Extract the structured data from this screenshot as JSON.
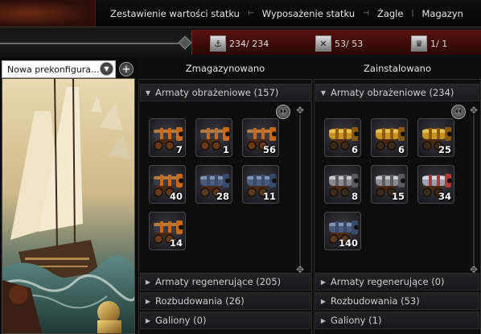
{
  "tabs": [
    {
      "label": "Zestawienie wartości statku"
    },
    {
      "label": "Wyposażenie statku"
    },
    {
      "label": "Żagle"
    },
    {
      "label": "Magazyn"
    }
  ],
  "tab_separators": [
    "⊢",
    "⊣",
    "|"
  ],
  "resources": [
    {
      "icon": "crew-icon",
      "value": "234/ 234"
    },
    {
      "icon": "cannon-slots-icon",
      "value": "53/ 53"
    },
    {
      "icon": "figurehead-icon",
      "value": "1/ 1"
    }
  ],
  "preset": {
    "label": "Nowa prekonfigura...",
    "add_label": "+",
    "arrow": "▼"
  },
  "stored": {
    "title": "Zmagazynowano",
    "categories": [
      {
        "label": "Armaty obrażeniowe (157)",
        "open": true
      },
      {
        "label": "Armaty regenerujące (205)",
        "open": false
      },
      {
        "label": "Rozbudowania (26)",
        "open": false
      },
      {
        "label": "Galiony (0)",
        "open": false
      }
    ],
    "items": [
      {
        "type": "orange-cannon",
        "count": "7"
      },
      {
        "type": "orange-cannon",
        "count": "1"
      },
      {
        "type": "orange-cannon",
        "count": "56"
      },
      {
        "type": "orange-cannon",
        "count": "40"
      },
      {
        "type": "blue-cannon",
        "count": "28"
      },
      {
        "type": "blue-cannon",
        "count": "11"
      },
      {
        "type": "orange-cannon",
        "count": "14"
      }
    ]
  },
  "installed": {
    "title": "Zainstalowano",
    "categories": [
      {
        "label": "Armaty obrażeniowe (234)",
        "open": true
      },
      {
        "label": "Armaty regenerujące (0)",
        "open": false
      },
      {
        "label": "Rozbudowania (53)",
        "open": false
      },
      {
        "label": "Galiony (1)",
        "open": false
      }
    ],
    "items": [
      {
        "type": "gold-cannon",
        "count": "6"
      },
      {
        "type": "gold-cannon",
        "count": "6"
      },
      {
        "type": "gold-cannon",
        "count": "25"
      },
      {
        "type": "silver-cannon",
        "count": "8"
      },
      {
        "type": "silver-cannon",
        "count": "15"
      },
      {
        "type": "silver-cannon-ornate",
        "count": "34"
      },
      {
        "type": "blue-cannon",
        "count": "140"
      }
    ]
  },
  "colors": {
    "accent_red": "#5a1410",
    "panel": "#0d0d0e",
    "category": "#1b1b1e"
  }
}
